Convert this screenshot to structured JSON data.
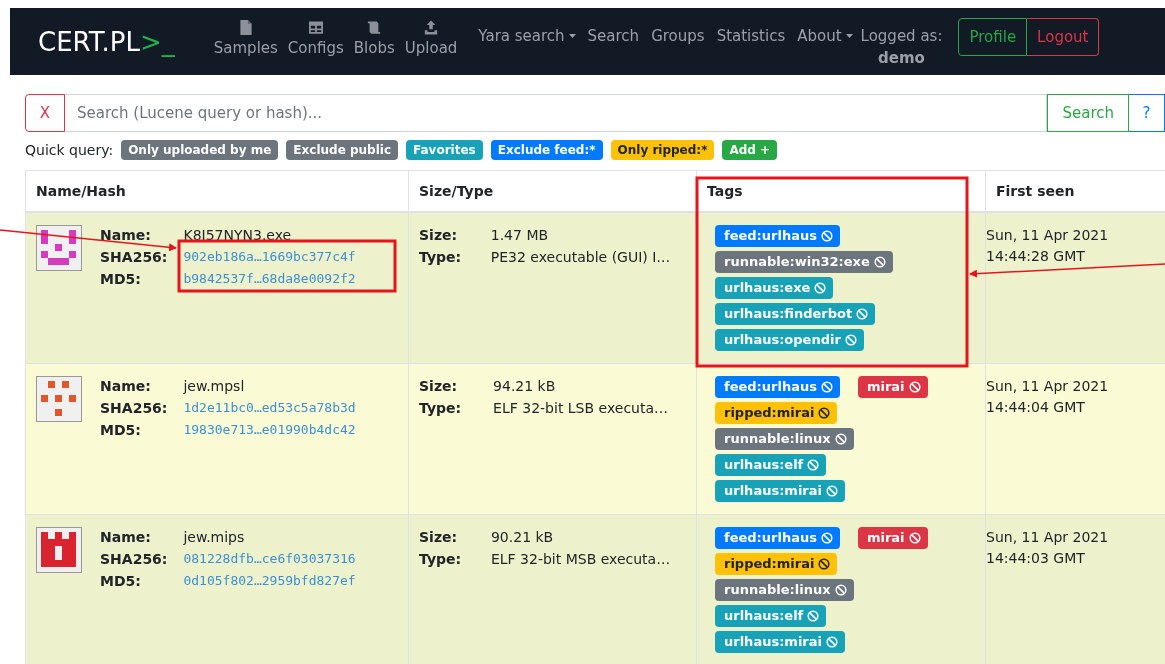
{
  "navbar": {
    "brand": "CERT.PL",
    "brand_suffix": ">_",
    "icon_links": [
      {
        "label": "Samples",
        "kind": "file"
      },
      {
        "label": "Configs",
        "kind": "table"
      },
      {
        "label": "Blobs",
        "kind": "scroll"
      },
      {
        "label": "Upload",
        "kind": "upload"
      }
    ],
    "links": [
      {
        "label": "Yara search",
        "dropdown": true
      },
      {
        "label": "Search",
        "dropdown": false
      },
      {
        "label": "Groups",
        "dropdown": false
      },
      {
        "label": "Statistics",
        "dropdown": false
      },
      {
        "label": "About",
        "dropdown": true
      }
    ],
    "logged_as_label": "Logged as:",
    "username": "demo",
    "buttons": [
      {
        "label": "Profile",
        "kind": "success"
      },
      {
        "label": "Logout",
        "kind": "danger"
      }
    ]
  },
  "search": {
    "clear": "X",
    "placeholder": "Search (Lucene query or hash)...",
    "submit": "Search",
    "help": "?"
  },
  "quick_query": {
    "label": "Quick query:",
    "badges": [
      {
        "label": "Only uploaded by me",
        "color": "#6c757d"
      },
      {
        "label": "Exclude public",
        "color": "#6c757d"
      },
      {
        "label": "Favorites",
        "color": "#17a2b8"
      },
      {
        "label": "Exclude feed:*",
        "color": "#007bff"
      },
      {
        "label": "Only ripped:*",
        "color": "#ffc107"
      },
      {
        "label": "Add +",
        "color": "#28a745"
      }
    ]
  },
  "table": {
    "columns": [
      "Name/Hash",
      "Size/Type",
      "Tags",
      "First seen"
    ],
    "rows": [
      {
        "name_label": "Name:",
        "name": "K8I57NYN3.exe",
        "sha256_label": "SHA256:",
        "sha256": "902eb186a…1669bc377c4f",
        "md5_label": "MD5:",
        "md5": "b9842537f…68da8e0092f2",
        "size_label": "Size:",
        "size": "1.47 MB",
        "type_label": "Type:",
        "type": "PE32 executable (GUI) I…",
        "tags": [
          {
            "label": "feed:urlhaus",
            "color": "#007bff"
          },
          {
            "label": "runnable:win32:exe",
            "color": "#6c757d"
          },
          {
            "label": "urlhaus:exe",
            "color": "#17a2b8"
          },
          {
            "label": "urlhaus:finderbot",
            "color": "#17a2b8"
          },
          {
            "label": "urlhaus:opendir",
            "color": "#17a2b8"
          }
        ],
        "first_seen": "Sun, 11 Apr 2021",
        "first_seen_time": "14:44:28 GMT"
      },
      {
        "name_label": "Name:",
        "name": "jew.mpsl",
        "sha256_label": "SHA256:",
        "sha256": "1d2e11bc0…ed53c5a78b3d",
        "md5_label": "MD5:",
        "md5": "19830e713…e01990b4dc42",
        "size_label": "Size:",
        "size": "94.21 kB",
        "type_label": "Type:",
        "type": "ELF 32-bit LSB executa…",
        "tags": [
          {
            "label": "feed:urlhaus",
            "color": "#007bff"
          },
          {
            "label": "mirai",
            "color": "#dc3545"
          },
          {
            "label": "ripped:mirai",
            "color": "#ffc107"
          },
          {
            "label": "runnable:linux",
            "color": "#6c757d"
          },
          {
            "label": "urlhaus:elf",
            "color": "#17a2b8"
          },
          {
            "label": "urlhaus:mirai",
            "color": "#17a2b8"
          }
        ],
        "first_seen": "Sun, 11 Apr 2021",
        "first_seen_time": "14:44:04 GMT"
      },
      {
        "name_label": "Name:",
        "name": "jew.mips",
        "sha256_label": "SHA256:",
        "sha256": "081228dfb…ce6f03037316",
        "md5_label": "MD5:",
        "md5": "0d105f802…2959bfd827ef",
        "size_label": "Size:",
        "size": "90.21 kB",
        "type_label": "Type:",
        "type": "ELF 32-bit MSB executa…",
        "tags": [
          {
            "label": "feed:urlhaus",
            "color": "#007bff"
          },
          {
            "label": "mirai",
            "color": "#dc3545"
          },
          {
            "label": "ripped:mirai",
            "color": "#ffc107"
          },
          {
            "label": "runnable:linux",
            "color": "#6c757d"
          },
          {
            "label": "urlhaus:elf",
            "color": "#17a2b8"
          },
          {
            "label": "urlhaus:mirai",
            "color": "#17a2b8"
          }
        ],
        "first_seen": "Sun, 11 Apr 2021",
        "first_seen_time": "14:44:03 GMT"
      }
    ]
  }
}
